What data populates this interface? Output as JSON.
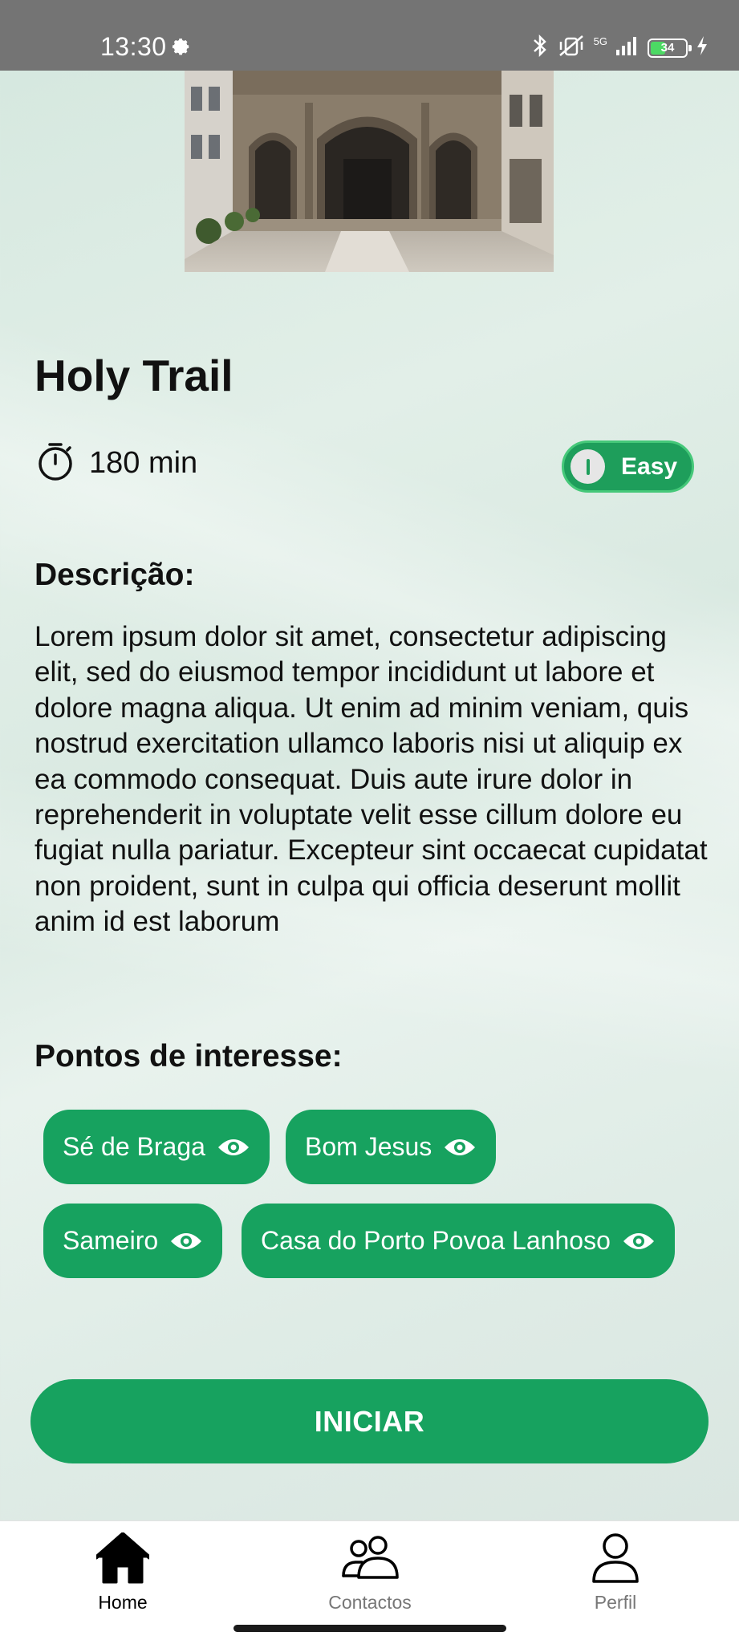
{
  "status_bar": {
    "time": "13:30",
    "network": "5G",
    "battery_level": "34"
  },
  "trail": {
    "title": "Holy Trail",
    "duration": "180 min",
    "difficulty": "Easy"
  },
  "description": {
    "heading": "Descrição:",
    "text": "Lorem ipsum dolor sit amet, consectetur adipiscing elit, sed do eiusmod tempor incididunt ut labore et dolore magna aliqua. Ut enim ad minim veniam, quis nostrud exercitation ullamco laboris nisi ut aliquip ex ea commodo consequat. Duis aute irure dolor in reprehenderit in voluptate velit esse cillum dolore eu fugiat nulla pariatur. Excepteur sint occaecat cupidatat non proident, sunt in culpa qui officia deserunt mollit anim id est laborum"
  },
  "points_of_interest": {
    "heading": "Pontos de interesse:",
    "items": [
      {
        "label": "Sé de Braga",
        "icon": "eye-icon"
      },
      {
        "label": "Bom Jesus",
        "icon": "eye-icon"
      },
      {
        "label": "Sameiro",
        "icon": "eye-icon"
      },
      {
        "label": "Casa do Porto Povoa Lanhoso",
        "icon": "eye-icon"
      }
    ]
  },
  "actions": {
    "start_label": "INICIAR"
  },
  "bottom_nav": {
    "items": [
      {
        "label": "Home",
        "icon": "home-icon",
        "active": true
      },
      {
        "label": "Contactos",
        "icon": "contacts-icon",
        "active": false
      },
      {
        "label": "Perfil",
        "icon": "profile-icon",
        "active": false
      }
    ]
  },
  "colors": {
    "primary": "#17a25f",
    "status_bar": "#747474",
    "background": "#dfece6"
  }
}
